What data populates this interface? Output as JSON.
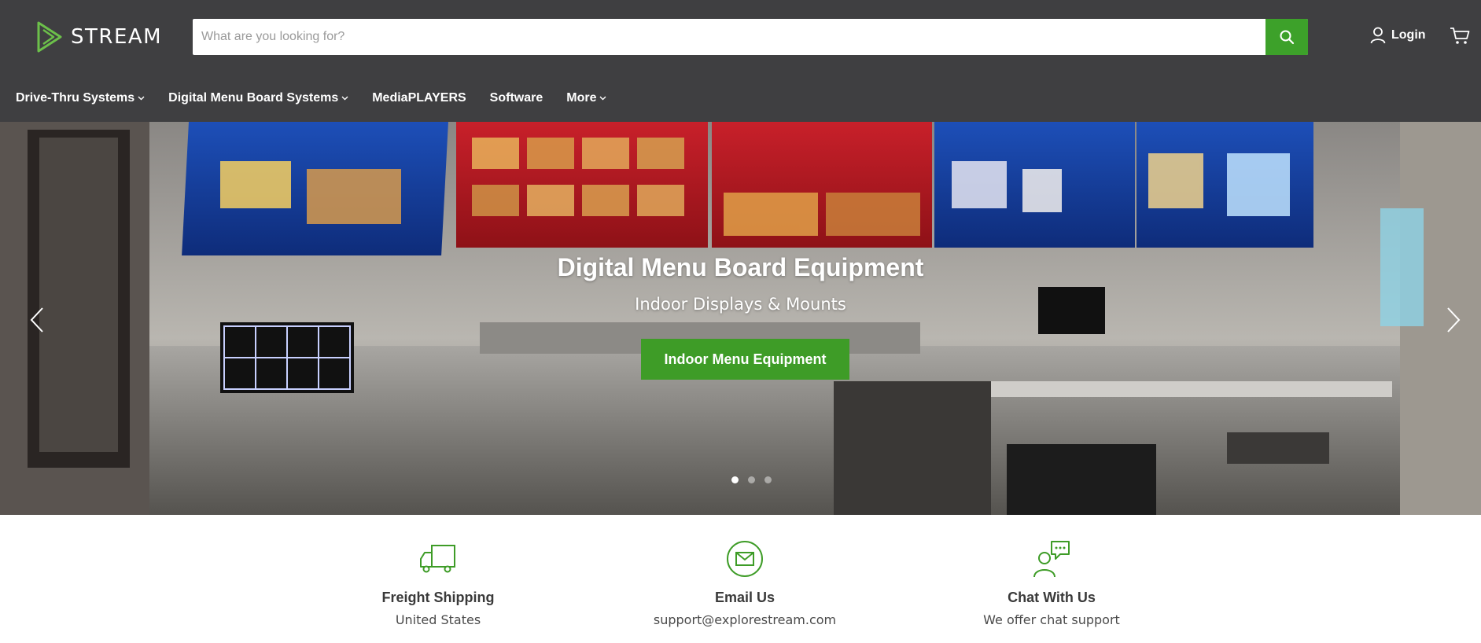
{
  "brand": {
    "name": "STREAM",
    "accent": "#3e9c27",
    "header_bg": "#3f3f41"
  },
  "search": {
    "placeholder": "What are you looking for?",
    "value": "",
    "button_icon": "search-icon"
  },
  "account": {
    "login_label": "Login",
    "login_icon": "user-icon",
    "cart_icon": "cart-icon"
  },
  "nav": {
    "items": [
      {
        "label": "Drive-Thru Systems",
        "has_dropdown": true
      },
      {
        "label": "Digital Menu Board Systems",
        "has_dropdown": true
      },
      {
        "label": "MediaPLAYERS",
        "has_dropdown": false
      },
      {
        "label": "Software",
        "has_dropdown": false
      },
      {
        "label": "More",
        "has_dropdown": true
      }
    ]
  },
  "hero": {
    "title": "Digital Menu Board Equipment",
    "subtitle": "Indoor Displays & Mounts",
    "cta_label": "Indoor Menu Equipment",
    "slides_count": 3,
    "active_slide": 1
  },
  "features": [
    {
      "icon": "truck-icon",
      "title": "Freight Shipping",
      "subtitle": "United States"
    },
    {
      "icon": "envelope-icon",
      "title": "Email Us",
      "subtitle": "support@explorestream.com"
    },
    {
      "icon": "chat-support-icon",
      "title": "Chat With Us",
      "subtitle": "We offer chat support"
    }
  ]
}
